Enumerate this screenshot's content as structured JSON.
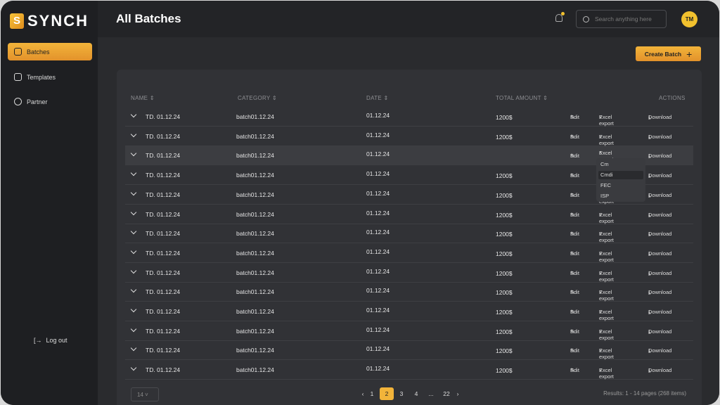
{
  "app": {
    "logo": "SYNCH",
    "title": "All Batches"
  },
  "sidebar": {
    "items": [
      {
        "label": "Batches",
        "active": true
      },
      {
        "label": "Templates"
      },
      {
        "label": "Partner"
      }
    ],
    "logout": "Log out"
  },
  "header": {
    "search_placeholder": "Search anything here",
    "avatar": "TM",
    "accent": "#f2b43a"
  },
  "toolbar": {
    "create": "Create Batch"
  },
  "table": {
    "columns": [
      "NAME",
      "CATEGORY",
      "DATE",
      "TOTAL AMOUNT",
      "ACTIONS"
    ],
    "actions": {
      "edit": "Edit",
      "export": "Excel export",
      "download": "Download"
    },
    "rows": [
      {
        "name": "TD. 01.12.24",
        "category": "batch01.12.24",
        "date": "01.12.24",
        "amount": "1200$"
      },
      {
        "name": "TD. 01.12.24",
        "category": "batch01.12.24",
        "date": "01.12.24",
        "amount": "1200$"
      },
      {
        "name": "TD. 01.12.24",
        "category": "batch01.12.24",
        "date": "01.12.24",
        "amount": ""
      },
      {
        "name": "TD. 01.12.24",
        "category": "batch01.12.24",
        "date": "01.12.24",
        "amount": "1200$"
      },
      {
        "name": "TD. 01.12.24",
        "category": "batch01.12.24",
        "date": "01.12.24",
        "amount": "1200$"
      },
      {
        "name": "TD. 01.12.24",
        "category": "batch01.12.24",
        "date": "01.12.24",
        "amount": "1200$"
      },
      {
        "name": "TD. 01.12.24",
        "category": "batch01.12.24",
        "date": "01.12.24",
        "amount": "1200$"
      },
      {
        "name": "TD. 01.12.24",
        "category": "batch01.12.24",
        "date": "01.12.24",
        "amount": "1200$"
      },
      {
        "name": "TD. 01.12.24",
        "category": "batch01.12.24",
        "date": "01.12.24",
        "amount": "1200$"
      },
      {
        "name": "TD. 01.12.24",
        "category": "batch01.12.24",
        "date": "01.12.24",
        "amount": "1200$"
      },
      {
        "name": "TD. 01.12.24",
        "category": "batch01.12.24",
        "date": "01.12.24",
        "amount": "1200$"
      },
      {
        "name": "TD. 01.12.24",
        "category": "batch01.12.24",
        "date": "01.12.24",
        "amount": "1200$"
      },
      {
        "name": "TD. 01.12.24",
        "category": "batch01.12.24",
        "date": "01.12.24",
        "amount": "1200$"
      },
      {
        "name": "TD. 01.12.24",
        "category": "batch01.12.24",
        "date": "01.12.24",
        "amount": "1200$"
      }
    ],
    "open_dropdown": {
      "row": 3,
      "options": [
        "Cm",
        "Cmdi",
        "FEC",
        "ISP"
      ],
      "hovered": "Cmdi"
    }
  },
  "pagination": {
    "page_size": "14",
    "pages": [
      "1",
      "2",
      "3",
      "4",
      "...",
      "22"
    ],
    "current": "2",
    "results": "Results: 1 - 14 pages  (268 items)"
  }
}
